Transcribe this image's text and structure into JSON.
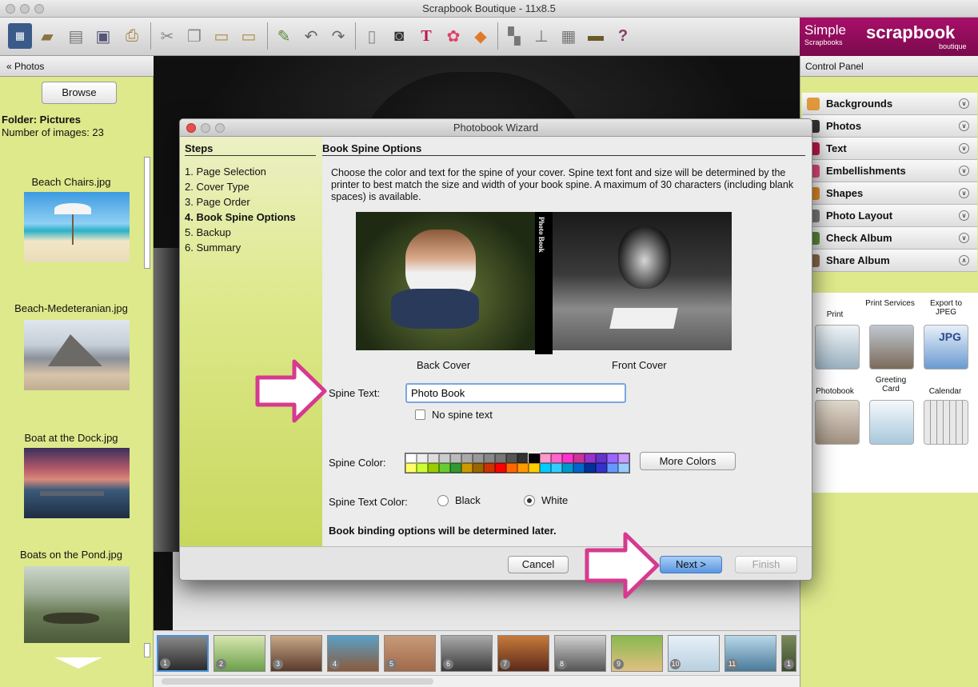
{
  "window": {
    "title": "Scrapbook Boutique - 11x8.5"
  },
  "brand": {
    "simple": "Simple",
    "scrapbooks": "Scrapbooks",
    "scrapbook": "scrapbook",
    "boutique": "boutique"
  },
  "left_panel": {
    "header": "« Photos",
    "browse_label": "Browse",
    "folder_label": "Folder: Pictures",
    "count_label": "Number of images: 23",
    "thumbnails": [
      {
        "label": "Beach Chairs.jpg"
      },
      {
        "label": "Beach-Medeteranian.jpg"
      },
      {
        "label": "Boat at the Dock.jpg"
      },
      {
        "label": "Boats on the Pond.jpg"
      }
    ]
  },
  "right_panel": {
    "header": "Control Panel",
    "items": [
      {
        "label": "Backgrounds",
        "state": "collapsed"
      },
      {
        "label": "Photos",
        "state": "collapsed"
      },
      {
        "label": "Text",
        "state": "collapsed"
      },
      {
        "label": "Embellishments",
        "state": "collapsed"
      },
      {
        "label": "Shapes",
        "state": "collapsed"
      },
      {
        "label": "Photo Layout",
        "state": "collapsed"
      },
      {
        "label": "Check Album",
        "state": "collapsed"
      },
      {
        "label": "Share Album",
        "state": "expanded"
      }
    ],
    "share": [
      {
        "label": "Print",
        "icon": "printer-icon"
      },
      {
        "label": "Print Services",
        "icon": "print-services-icon"
      },
      {
        "label": "Export to JPEG",
        "icon": "export-jpeg-icon",
        "badge": "JPG"
      },
      {
        "label": "Photobook",
        "icon": "photobook-icon"
      },
      {
        "label": "Greeting Card",
        "icon": "greeting-card-icon"
      },
      {
        "label": "Calendar",
        "icon": "calendar-icon"
      }
    ]
  },
  "filmstrip": {
    "numbers": [
      "1",
      "2",
      "3",
      "4",
      "5",
      "6",
      "7",
      "8",
      "9",
      "10",
      "11",
      "1"
    ]
  },
  "dialog": {
    "title": "Photobook Wizard",
    "steps_header": "Steps",
    "steps": [
      {
        "label": "1. Page Selection",
        "active": false
      },
      {
        "label": "2. Cover Type",
        "active": false
      },
      {
        "label": "3. Page Order",
        "active": false
      },
      {
        "label": "4. Book Spine Options",
        "active": true
      },
      {
        "label": "5. Backup",
        "active": false
      },
      {
        "label": "6. Summary",
        "active": false
      }
    ],
    "section_title": "Book Spine Options",
    "description": "Choose the color and text for the spine of your cover. Spine text font and size will be determined by the printer to best match the size and width of your book spine. A maximum of 30 characters (including blank spaces) is available.",
    "back_cover_caption": "Back Cover",
    "front_cover_caption": "Front Cover",
    "spine_preview_text": "Photo Book",
    "spine_text_label": "Spine Text:",
    "spine_text_value": "Photo Book",
    "no_spine_label": "No spine text",
    "no_spine_checked": false,
    "spine_color_label": "Spine Color:",
    "more_colors_label": "More Colors",
    "spine_text_color_label": "Spine Text Color:",
    "text_color_options": [
      {
        "label": "Black",
        "selected": false
      },
      {
        "label": "White",
        "selected": true
      }
    ],
    "binding_note": "Book binding options will be determined later.",
    "buttons": {
      "cancel": "Cancel",
      "next": "Next >",
      "finish": "Finish"
    },
    "palette": [
      "#ffffff",
      "#eeeeee",
      "#dddddd",
      "#cccccc",
      "#bbbbbb",
      "#aaaaaa",
      "#999999",
      "#888888",
      "#777777",
      "#555555",
      "#333333",
      "#000000",
      "#ff99cc",
      "#ff66cc",
      "#ff33cc",
      "#cc3399",
      "#9933cc",
      "#6633cc",
      "#9966ff",
      "#cc99ff",
      "#ffff66",
      "#ccff33",
      "#99cc00",
      "#66cc33",
      "#339933",
      "#cc9900",
      "#996600",
      "#cc3300",
      "#ff0000",
      "#ff6600",
      "#ff9900",
      "#ffcc00",
      "#00ccff",
      "#33ccff",
      "#0099cc",
      "#0066cc",
      "#003399",
      "#3333cc",
      "#6699ff",
      "#99ccff"
    ]
  },
  "colors": {
    "panel_green": "#dde98b",
    "accent_pink": "#e03a9a",
    "brand_magenta": "#8f0d5c",
    "next_blue": "#6ea6ea"
  }
}
